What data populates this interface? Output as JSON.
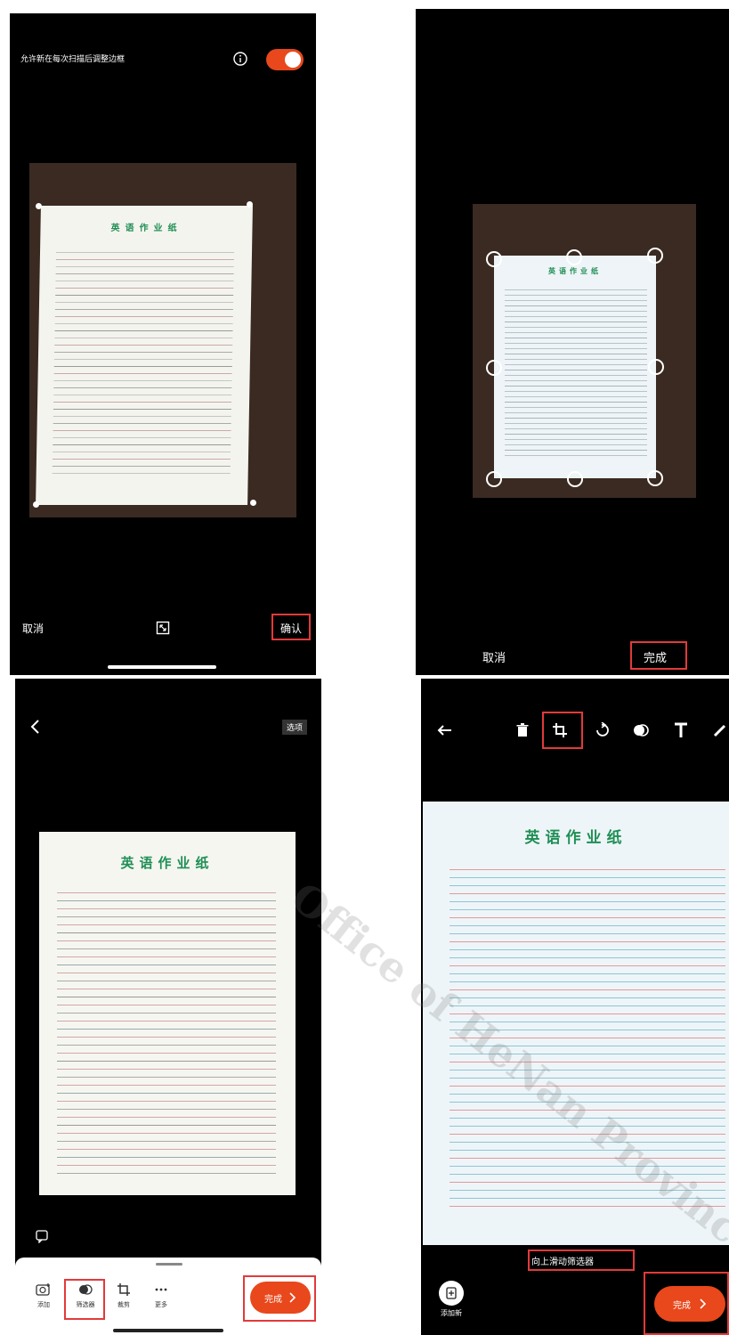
{
  "panel1": {
    "header_text": "允许新在每次扫描后调整边框",
    "info_icon": "info-icon",
    "toggle_state": "on",
    "cancel_label": "取消",
    "confirm_label": "确认",
    "crop_icon": "auto-crop-icon"
  },
  "panel2": {
    "cancel_label": "取消",
    "done_label": "完成"
  },
  "panel3": {
    "back_icon": "chevron-left-icon",
    "options_label": "选项",
    "toolbar": [
      {
        "icon": "add-icon",
        "label": "添加"
      },
      {
        "icon": "filter-icon",
        "label": "筛选器"
      },
      {
        "icon": "crop-icon",
        "label": "裁剪"
      },
      {
        "icon": "more-icon",
        "label": "更多"
      }
    ],
    "done_label": "完成"
  },
  "panel4": {
    "toolbar_icons": [
      "arrow-left-icon",
      "trash-icon",
      "crop-icon",
      "rotate-icon",
      "filter-icon",
      "text-icon",
      "pen-icon"
    ],
    "swipe_hint": "向上滑动筛选器",
    "add_new_label": "添加新",
    "done_label": "完成"
  },
  "document": {
    "title": "英语作业纸"
  },
  "watermark": {
    "text": "Office of HeNan Province"
  },
  "colors": {
    "accent": "#e8481c",
    "highlight": "#e23a3a",
    "title_green": "#1f8f55"
  }
}
